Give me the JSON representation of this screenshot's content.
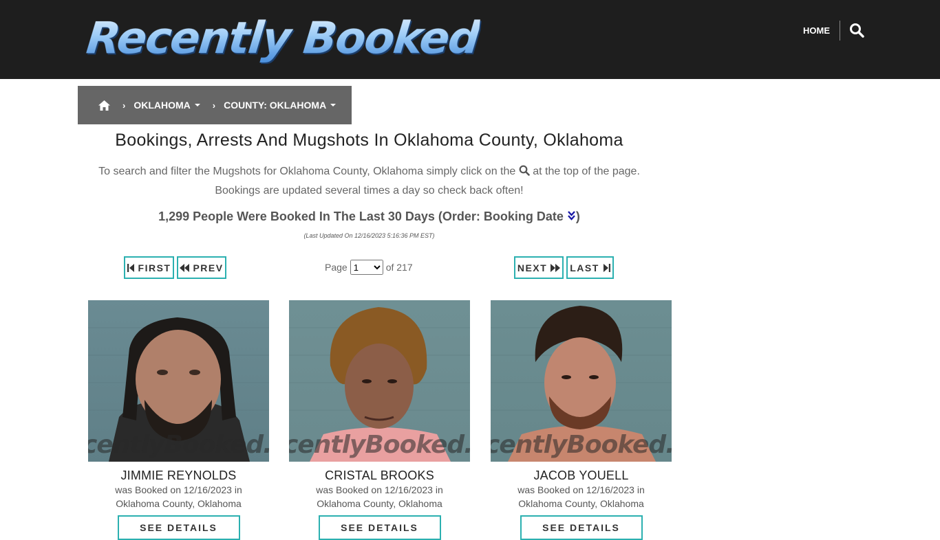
{
  "header": {
    "logo_text": "Recently Booked",
    "nav_home": "HOME"
  },
  "breadcrumb": {
    "home_icon": "home-icon",
    "state": "OKLAHOMA",
    "county": "COUNTY: OKLAHOMA"
  },
  "page": {
    "title": "Bookings, Arrests And Mugshots In Oklahoma County, Oklahoma",
    "intro_before": "To search and filter the Mugshots for Oklahoma County, Oklahoma simply click on the",
    "intro_after": "at the top of the page.",
    "intro_line2": "Bookings are updated several times a day so check back often!",
    "count_text": "1,299 People Were Booked In The Last 30 Days (Order: Booking Date",
    "count_close": ")",
    "last_updated": "(Last Updated On 12/16/2023 5:16:36 PM EST)"
  },
  "pager": {
    "first": "FIRST",
    "prev": "PREV",
    "next": "NEXT",
    "last": "LAST",
    "page_label": "Page",
    "page_value": "1",
    "of_label": "of 217"
  },
  "cards": [
    {
      "name": "JIMMIE REYNOLDS",
      "booked": "was Booked on 12/16/2023 in",
      "location": "Oklahoma County, Oklahoma",
      "watermark": "centlyBooked.co",
      "button": "SEE DETAILS"
    },
    {
      "name": "CRISTAL BROOKS",
      "booked": "was Booked on 12/16/2023 in",
      "location": "Oklahoma County, Oklahoma",
      "watermark": "centlyBooked.co",
      "button": "SEE DETAILS"
    },
    {
      "name": "JACOB YOUELL",
      "booked": "was Booked on 12/16/2023 in",
      "location": "Oklahoma County, Oklahoma",
      "watermark": "centlyBooked.co",
      "button": "SEE DETAILS"
    }
  ],
  "colors": {
    "header_bg": "#1e1e1e",
    "breadcrumb_bg": "#666666",
    "button_border": "#2bb0b0",
    "sort_icon": "#1a1aa6"
  }
}
